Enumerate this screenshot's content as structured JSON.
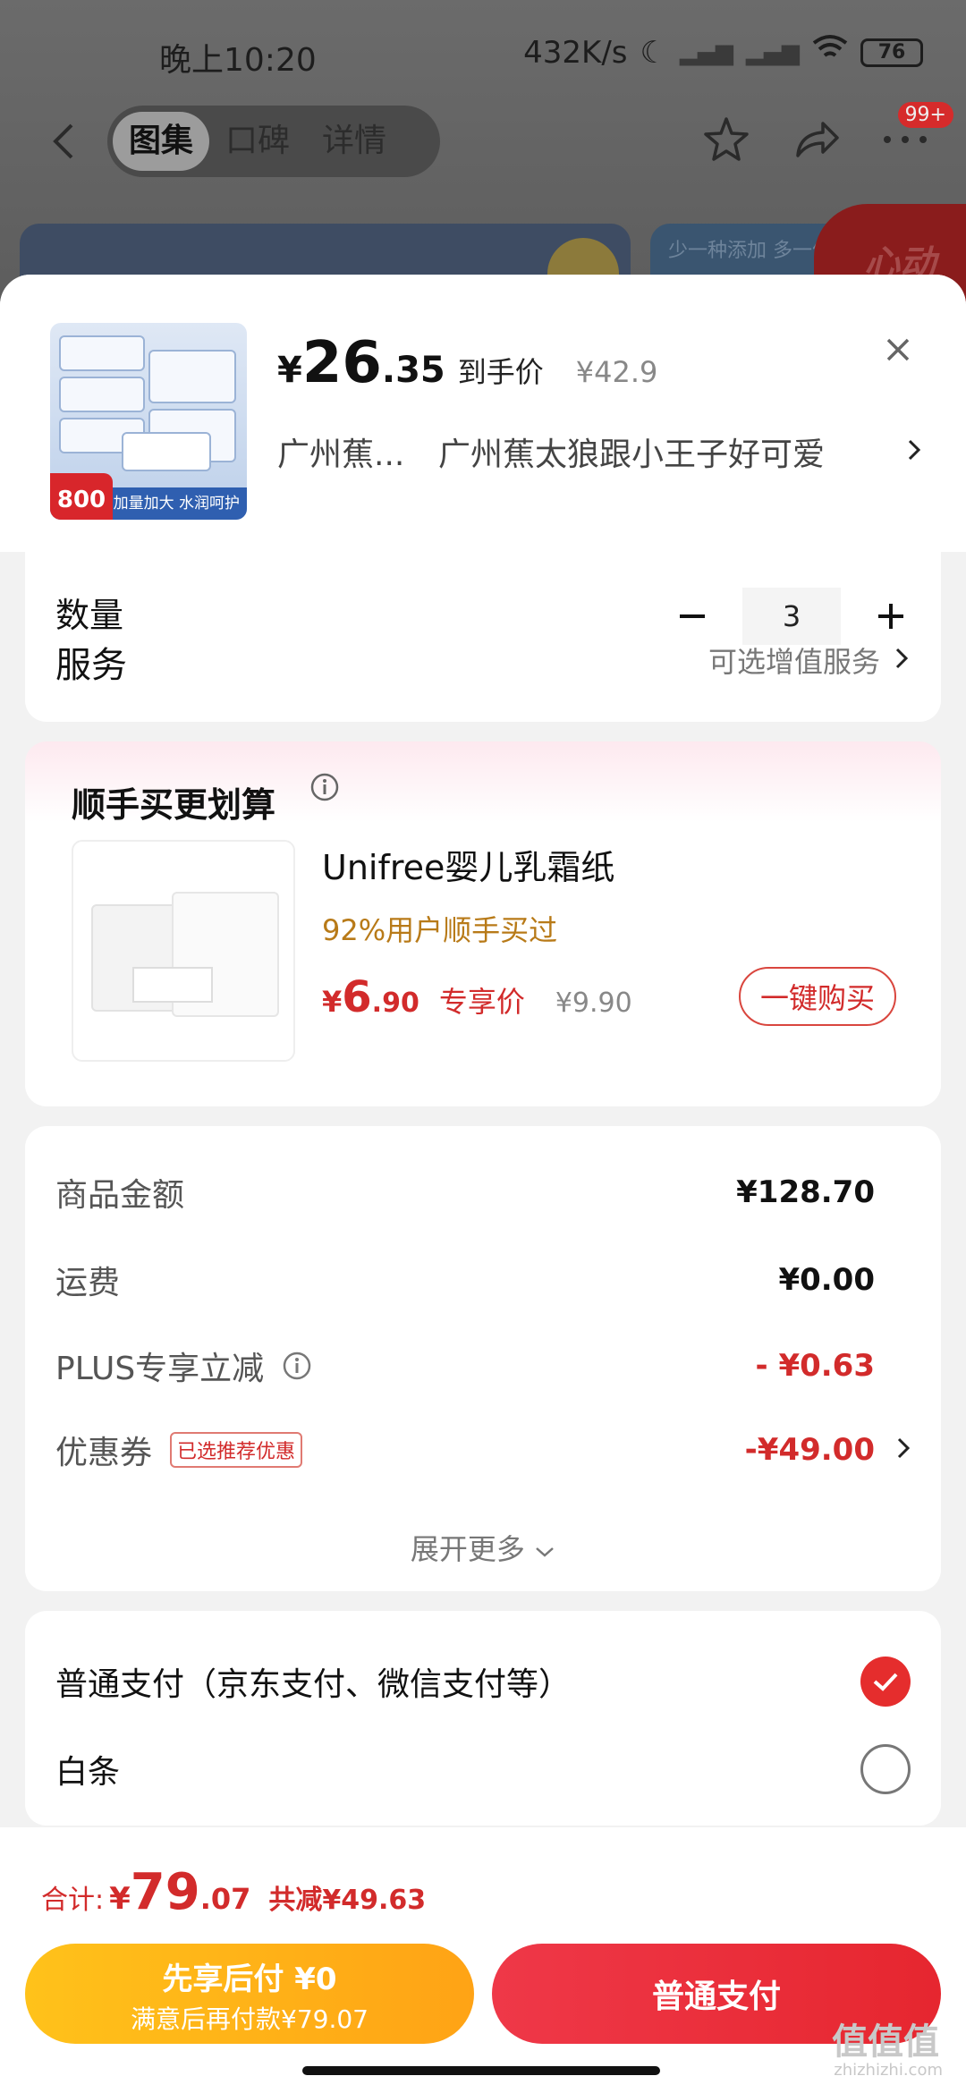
{
  "status_bar": {
    "time": "晚上10:20",
    "speed": "432K/s",
    "battery": "76"
  },
  "nav": {
    "tabs": [
      {
        "label": "图集"
      },
      {
        "label": "口碑"
      },
      {
        "label": "详情"
      }
    ],
    "badge": "99+"
  },
  "background": {
    "banner_text": "少一种添加 多一份",
    "corner_text": "心动"
  },
  "product": {
    "price_symbol": "¥",
    "price_int": "26",
    "price_dec": ".35",
    "price_label": "到手价",
    "original_price": "¥42.9",
    "spec_short": "广州蕉...",
    "spec_full": "广州蕉太狼跟小王子好可爱",
    "thumb_badge": "800",
    "thumb_caption": "加量加大 水润呵护"
  },
  "quantity": {
    "label": "数量",
    "value": "3"
  },
  "service": {
    "label": "服务",
    "hint": "可选增值服务"
  },
  "bundle": {
    "title": "顺手买更划算",
    "item_name": "Unifree婴儿乳霜纸",
    "popularity": "92%用户顺手买过",
    "price_symbol": "¥",
    "price_int": "6",
    "price_dec": ".90",
    "price_label": "专享价",
    "original_price": "¥9.90",
    "buy_label": "一键购买"
  },
  "amounts": {
    "goods_label": "商品金额",
    "goods_value": "¥128.70",
    "shipping_label": "运费",
    "shipping_value": "¥0.00",
    "plus_label": "PLUS专享立减",
    "plus_value": "- ¥0.63",
    "coupon_label": "优惠券",
    "coupon_tag": "已选推荐优惠",
    "coupon_value": "-¥49.00",
    "expand_label": "展开更多"
  },
  "payment": {
    "options": [
      {
        "label": "普通支付（京东支付、微信支付等）",
        "selected": true
      },
      {
        "label": "白条",
        "selected": false
      }
    ]
  },
  "footer": {
    "total_label": "合计:",
    "total_symbol": "¥",
    "total_int": "79",
    "total_dec": ".07",
    "saved": "共减¥49.63",
    "later_line1": "先享后付 ¥0",
    "later_line2": "满意后再付款¥79.07",
    "pay_label": "普通支付"
  },
  "watermark": {
    "main": "值值值",
    "sub": "zhizhizhi.com"
  },
  "colors": {
    "accent_red": "#d22b2b",
    "pay_red": "#e6262f",
    "later_yellow": "#ffb21a",
    "bundle_gold": "#b87a18"
  }
}
